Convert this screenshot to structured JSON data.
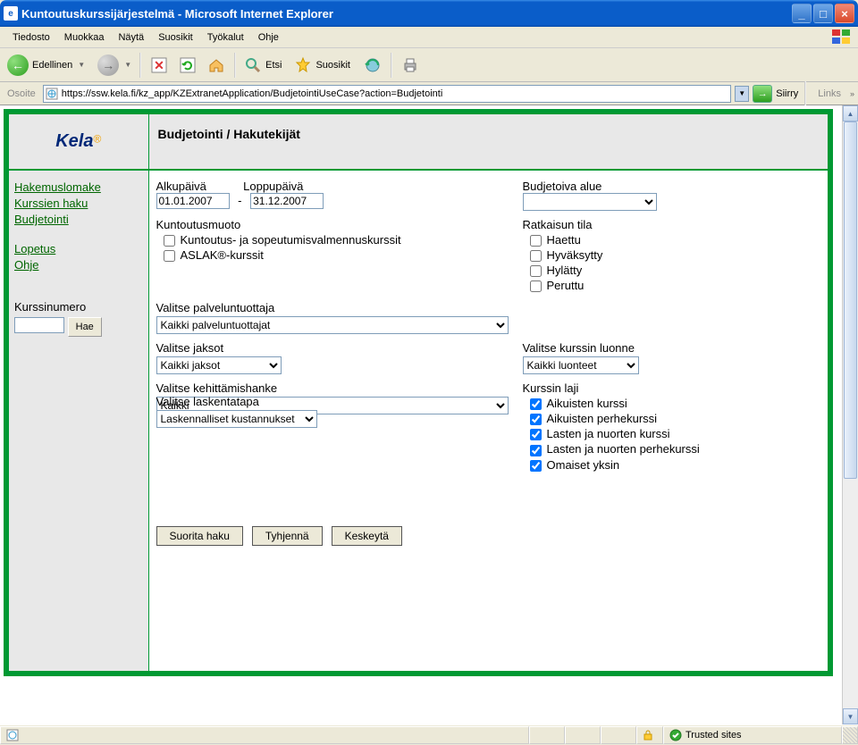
{
  "window": {
    "title": "Kuntoutuskurssijärjestelmä - Microsoft Internet Explorer"
  },
  "menu": {
    "items": [
      "Tiedosto",
      "Muokkaa",
      "Näytä",
      "Suosikit",
      "Työkalut",
      "Ohje"
    ]
  },
  "toolbar": {
    "back": "Edellinen",
    "search": "Etsi",
    "favorites": "Suosikit"
  },
  "addressbar": {
    "label": "Osoite",
    "url": "https://ssw.kela.fi/kz_app/KZExtranetApplication/BudjetointiUseCase?action=Budjetointi",
    "go": "Siirry",
    "links": "Links"
  },
  "page": {
    "logo": "Kela",
    "title": "Budjetointi / Hakutekijät",
    "nav": {
      "group1": [
        "Hakemuslomake",
        "Kurssien haku",
        "Budjetointi"
      ],
      "group2": [
        "Lopetus",
        "Ohje"
      ],
      "kurssi_label": "Kurssinumero",
      "hae": "Hae"
    },
    "form": {
      "alkupaiva_label": "Alkupäivä",
      "loppupaiva_label": "Loppupäivä",
      "alkupaiva": "01.01.2007",
      "loppupaiva": "31.12.2007",
      "budjetoiva_alue_label": "Budjetoiva alue",
      "kuntoutusmuoto_label": "Kuntoutusmuoto",
      "km_opt1": "Kuntoutus- ja sopeutumisvalmennuskurssit",
      "km_opt2": "ASLAK®-kurssit",
      "ratkaisun_tila_label": "Ratkaisun tila",
      "rt_opt1": "Haettu",
      "rt_opt2": "Hyväksytty",
      "rt_opt3": "Hylätty",
      "rt_opt4": "Peruttu",
      "palveluntuottaja_label": "Valitse palveluntuottaja",
      "palveluntuottaja_value": "Kaikki palveluntuottajat",
      "jaksot_label": "Valitse jaksot",
      "jaksot_value": "Kaikki jaksot",
      "kurssin_luonne_label": "Valitse kurssin luonne",
      "kurssin_luonne_value": "Kaikki luonteet",
      "kehittamishanke_label": "Valitse kehittämishanke",
      "kehittamishanke_value": "Kaikki",
      "laskentatapa_label": "Valitse laskentatapa",
      "laskentatapa_value": "Laskennalliset kustannukset",
      "kurssin_laji_label": "Kurssin laji",
      "kl_opt1": "Aikuisten kurssi",
      "kl_opt2": "Aikuisten perhekurssi",
      "kl_opt3": "Lasten ja nuorten kurssi",
      "kl_opt4": "Lasten ja nuorten perhekurssi",
      "kl_opt5": "Omaiset yksin",
      "btn_search": "Suorita haku",
      "btn_clear": "Tyhjennä",
      "btn_cancel": "Keskeytä"
    }
  },
  "statusbar": {
    "zone": "Trusted sites"
  }
}
